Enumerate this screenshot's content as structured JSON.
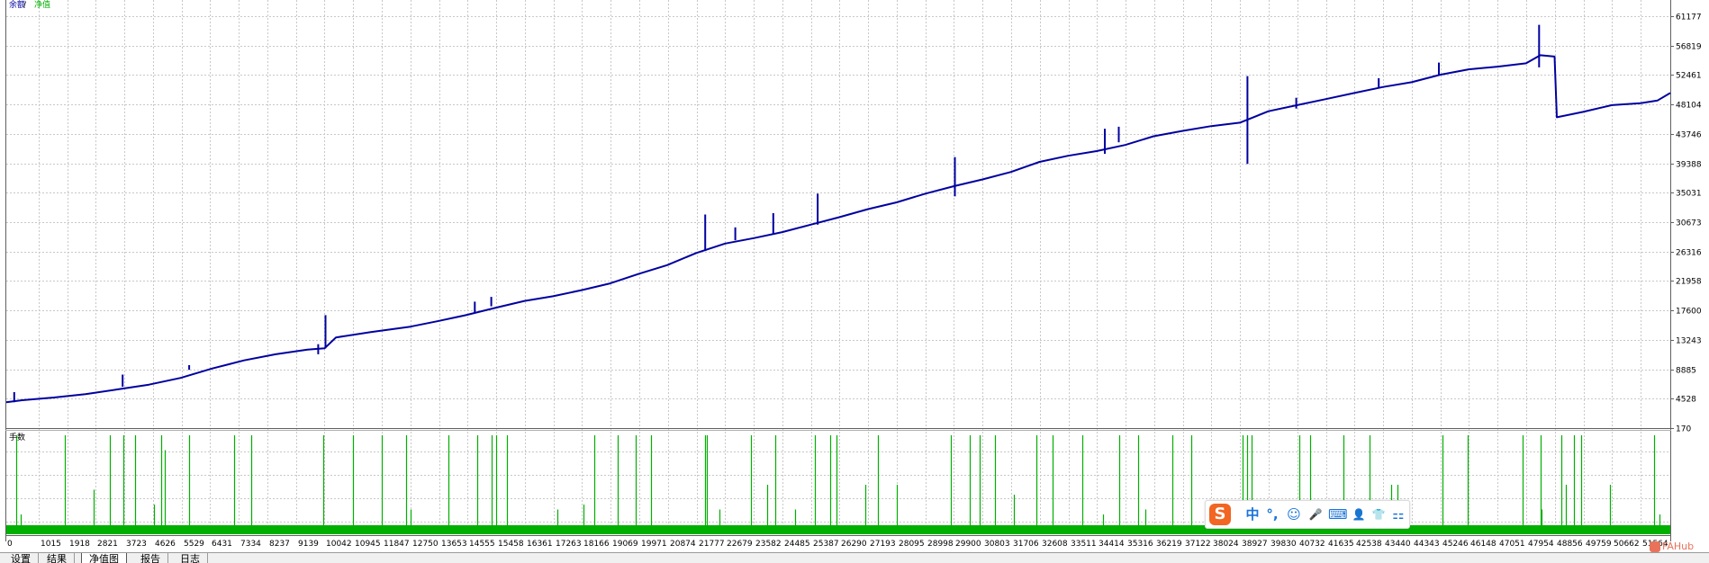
{
  "chart_data": [
    {
      "type": "line",
      "title": "",
      "legend": {
        "entries": [
          "余额",
          "净值"
        ],
        "separator": " / ",
        "colors": [
          "#0000a0",
          "#00b000"
        ],
        "placement": "top-left"
      },
      "ylim": [
        170,
        63000
      ],
      "y_ticks": [
        170,
        4528,
        8885,
        13243,
        17600,
        21958,
        26316,
        30673,
        35031,
        39388,
        43746,
        48104,
        52461,
        56819,
        61177
      ],
      "y_tick_labels": [
        "170",
        "4528",
        "8885",
        "13243",
        "17600",
        "21958",
        "26316",
        "30673",
        "35031",
        "39388",
        "43746",
        "48104",
        "52461",
        "56819",
        "61177"
      ],
      "xlim": [
        0,
        52500
      ],
      "grid": true,
      "series": [
        {
          "color": "#0000a0",
          "points": [
            [
              0,
              4000
            ],
            [
              500,
              4300
            ],
            [
              1500,
              4700
            ],
            [
              2500,
              5200
            ],
            [
              3500,
              5900
            ],
            [
              4500,
              6600
            ],
            [
              5500,
              7600
            ],
            [
              6500,
              9000
            ],
            [
              7500,
              10200
            ],
            [
              8500,
              11100
            ],
            [
              9500,
              11800
            ],
            [
              10045,
              12000
            ],
            [
              10400,
              13600
            ],
            [
              11500,
              14400
            ],
            [
              12750,
              15200
            ],
            [
              13600,
              16000
            ],
            [
              14500,
              16900
            ],
            [
              15450,
              18000
            ],
            [
              16350,
              19000
            ],
            [
              17250,
              19700
            ],
            [
              18150,
              20600
            ],
            [
              19050,
              21600
            ],
            [
              19950,
              23000
            ],
            [
              20850,
              24300
            ],
            [
              21770,
              26100
            ],
            [
              22680,
              27500
            ],
            [
              23580,
              28300
            ],
            [
              24480,
              29200
            ],
            [
              25380,
              30300
            ],
            [
              26280,
              31400
            ],
            [
              27190,
              32600
            ],
            [
              28090,
              33600
            ],
            [
              29000,
              34900
            ],
            [
              29900,
              36000
            ],
            [
              30800,
              37000
            ],
            [
              31700,
              38100
            ],
            [
              32600,
              39600
            ],
            [
              33500,
              40500
            ],
            [
              34400,
              41200
            ],
            [
              35300,
              42100
            ],
            [
              36200,
              43400
            ],
            [
              37120,
              44200
            ],
            [
              38020,
              44900
            ],
            [
              38920,
              45400
            ],
            [
              39820,
              47100
            ],
            [
              40730,
              48000
            ],
            [
              41630,
              48900
            ],
            [
              42530,
              49800
            ],
            [
              43440,
              50700
            ],
            [
              44340,
              51400
            ],
            [
              45240,
              52500
            ],
            [
              46140,
              53300
            ],
            [
              47050,
              53700
            ],
            [
              47950,
              54200
            ],
            [
              48400,
              55400
            ],
            [
              48850,
              55200
            ],
            [
              48920,
              46200
            ],
            [
              49750,
              47000
            ],
            [
              50660,
              48000
            ],
            [
              51560,
              48300
            ],
            [
              52100,
              48700
            ],
            [
              52500,
              49800
            ]
          ],
          "spikes": [
            [
              250,
              4000,
              5500
            ],
            [
              3670,
              6300,
              8100
            ],
            [
              5770,
              8800,
              9500
            ],
            [
              9840,
              11100,
              12600
            ],
            [
              10070,
              12000,
              16900
            ],
            [
              14780,
              17200,
              18900
            ],
            [
              15300,
              18200,
              19600
            ],
            [
              22050,
              26400,
              31800
            ],
            [
              23000,
              28000,
              29900
            ],
            [
              24200,
              29000,
              32000
            ],
            [
              25600,
              30300,
              34900
            ],
            [
              29930,
              34500,
              40300
            ],
            [
              34660,
              40800,
              44500
            ],
            [
              35100,
              42500,
              44800
            ],
            [
              39160,
              39300,
              52300
            ],
            [
              40700,
              47500,
              49100
            ],
            [
              43300,
              50600,
              52000
            ],
            [
              45200,
              52400,
              54300
            ],
            [
              48360,
              53600,
              59900
            ]
          ]
        }
      ]
    },
    {
      "type": "bar",
      "title": "",
      "label": "手数",
      "x_ticks": [
        0,
        1015,
        1918,
        2821,
        3723,
        4626,
        5529,
        6431,
        7334,
        8237,
        9139,
        10042,
        10945,
        11847,
        12750,
        13653,
        14555,
        15458,
        16361,
        17263,
        18166,
        19069,
        19971,
        20874,
        21777,
        22679,
        23582,
        24485,
        25387,
        26290,
        27193,
        28095,
        28998,
        29900,
        30803,
        31706,
        32608,
        33511,
        34414,
        35316,
        36219,
        37122,
        38024,
        38927,
        39830,
        40732,
        41635,
        42538,
        43440,
        44343,
        45246,
        46148,
        47051,
        47954,
        48856,
        49759,
        50662,
        51564
      ],
      "x_tick_labels": [
        "0",
        "1015",
        "1918",
        "2821",
        "3723",
        "4626",
        "5529",
        "6431",
        "7334",
        "8237",
        "9139",
        "10042",
        "10945",
        "11847",
        "12750",
        "13653",
        "14555",
        "15458",
        "16361",
        "17263",
        "18166",
        "19069",
        "19971",
        "20874",
        "21777",
        "22679",
        "23582",
        "24485",
        "25387",
        "26290",
        "27193",
        "28095",
        "28998",
        "29900",
        "30803",
        "31706",
        "32608",
        "33511",
        "34414",
        "35316",
        "36219",
        "37122",
        "38024",
        "38927",
        "39830",
        "40732",
        "41635",
        "42538",
        "43440",
        "44343",
        "45246",
        "46148",
        "47051",
        "47954",
        "48856",
        "49759",
        "50662",
        "51564"
      ],
      "color": "#00b000",
      "baseline_fill_level": 0.12,
      "values": [
        [
          300,
          1.0
        ],
        [
          450,
          0.2
        ],
        [
          1850,
          1.0
        ],
        [
          2750,
          0.45
        ],
        [
          3270,
          1.0
        ],
        [
          3700,
          1.0
        ],
        [
          4070,
          1.0
        ],
        [
          4650,
          0.3
        ],
        [
          4900,
          1.0
        ],
        [
          5000,
          0.85
        ],
        [
          5780,
          1.0
        ],
        [
          7200,
          1.0
        ],
        [
          7720,
          1.0
        ],
        [
          10000,
          1.0
        ],
        [
          10950,
          1.0
        ],
        [
          11850,
          1.0
        ],
        [
          12600,
          1.0
        ],
        [
          12750,
          0.25
        ],
        [
          13950,
          1.0
        ],
        [
          14850,
          1.0
        ],
        [
          15300,
          1.0
        ],
        [
          15450,
          1.0
        ],
        [
          15800,
          1.0
        ],
        [
          17400,
          0.25
        ],
        [
          18200,
          0.3
        ],
        [
          18540,
          1.0
        ],
        [
          19300,
          1.0
        ],
        [
          19870,
          1.0
        ],
        [
          20350,
          1.0
        ],
        [
          22050,
          1.0
        ],
        [
          22100,
          1.0
        ],
        [
          22500,
          0.25
        ],
        [
          23500,
          1.0
        ],
        [
          24000,
          0.5
        ],
        [
          24250,
          1.0
        ],
        [
          24900,
          0.25
        ],
        [
          25500,
          1.0
        ],
        [
          26000,
          1.0
        ],
        [
          26200,
          1.0
        ],
        [
          27100,
          0.5
        ],
        [
          27500,
          1.0
        ],
        [
          28100,
          0.5
        ],
        [
          29800,
          1.0
        ],
        [
          30400,
          1.0
        ],
        [
          30700,
          1.0
        ],
        [
          31200,
          1.0
        ],
        [
          31800,
          0.4
        ],
        [
          32500,
          1.0
        ],
        [
          33000,
          1.0
        ],
        [
          33950,
          1.0
        ],
        [
          34600,
          0.2
        ],
        [
          35100,
          1.0
        ],
        [
          35700,
          1.0
        ],
        [
          35950,
          0.25
        ],
        [
          36800,
          1.0
        ],
        [
          37400,
          1.0
        ],
        [
          39000,
          1.0
        ],
        [
          39150,
          1.0
        ],
        [
          39300,
          1.0
        ],
        [
          40800,
          1.0
        ],
        [
          41150,
          1.0
        ],
        [
          42200,
          1.0
        ],
        [
          43000,
          1.0
        ],
        [
          43700,
          0.5
        ],
        [
          43900,
          0.5
        ],
        [
          45300,
          1.0
        ],
        [
          46100,
          1.0
        ],
        [
          47850,
          1.0
        ],
        [
          48400,
          1.0
        ],
        [
          48450,
          0.25
        ],
        [
          49050,
          1.0
        ],
        [
          49200,
          0.5
        ],
        [
          49450,
          1.0
        ],
        [
          49700,
          1.0
        ],
        [
          50600,
          0.5
        ],
        [
          52000,
          1.0
        ],
        [
          52150,
          0.2
        ]
      ]
    }
  ],
  "tabs": [
    "设置",
    "结果",
    "净值图",
    "报告",
    "日志"
  ],
  "active_tab": "净值图",
  "ime_toolbar": {
    "logo": "S",
    "items": [
      "中",
      "°,",
      "☺",
      "🎤",
      "⌨",
      "👤",
      "👕",
      "⚏"
    ]
  },
  "watermark": "FAHub"
}
